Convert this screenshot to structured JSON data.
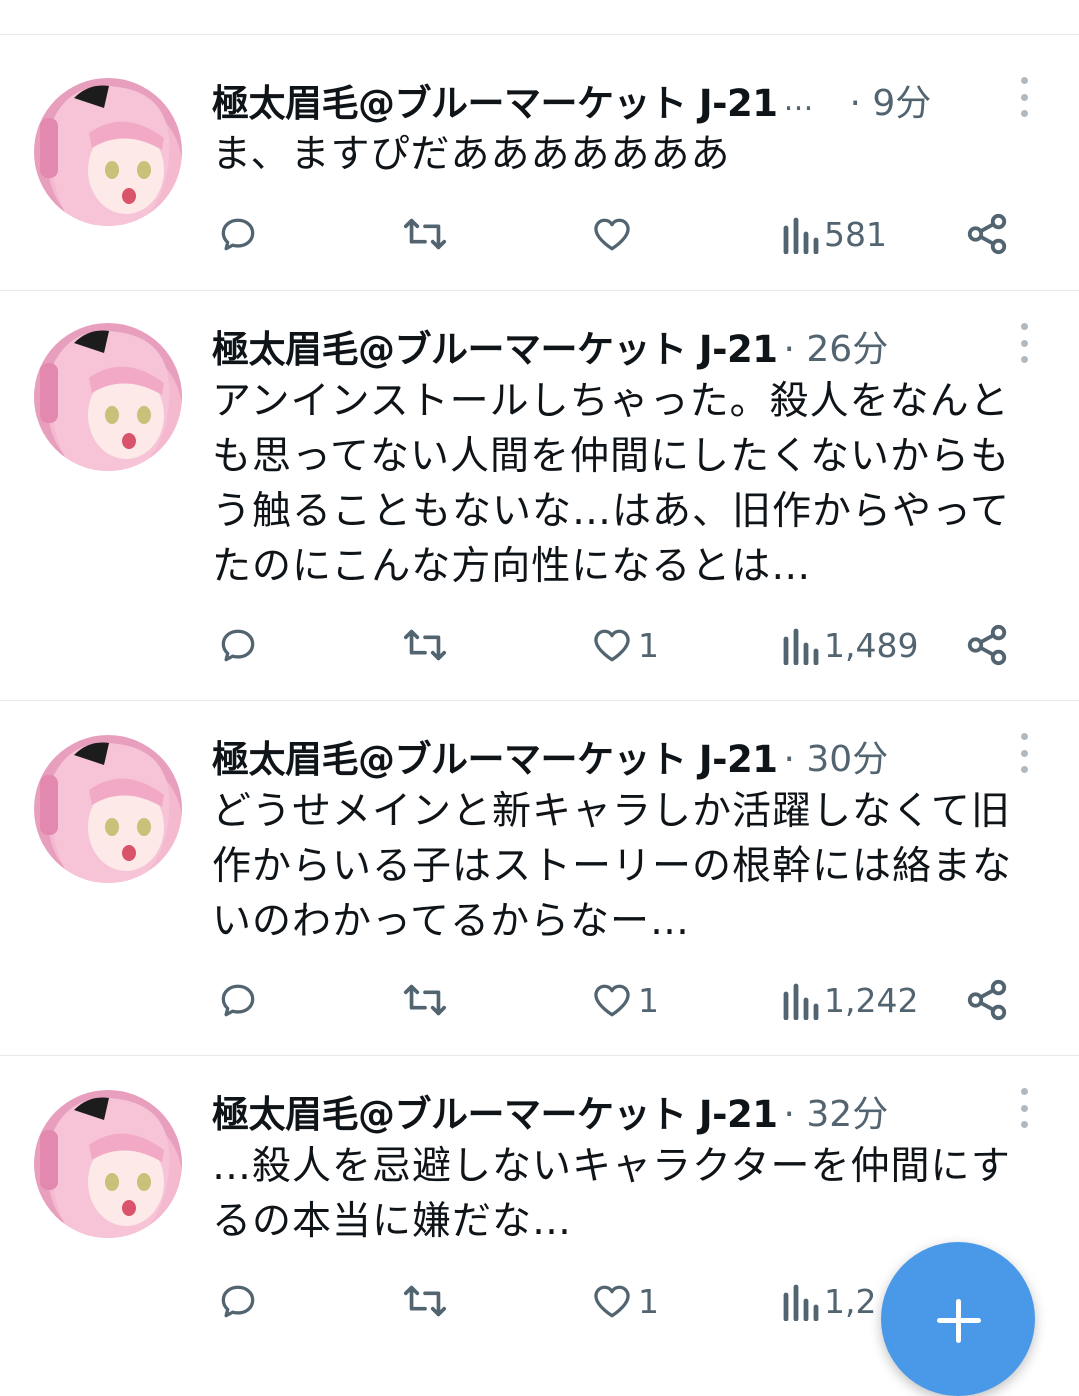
{
  "timeline": {
    "tweets": [
      {
        "author": "極太眉毛@ブルーマーケット J-21",
        "truncation": "…",
        "time": "· 9分",
        "text_lines": [
          "ま、ますぴだあああああああ"
        ],
        "reply_count": "",
        "retweet_count": "",
        "like_count": "",
        "views": "581"
      },
      {
        "author": "極太眉毛@ブルーマーケット J-21",
        "time": "· 26分",
        "text_lines": [
          "アンインストールしちゃった。殺人をなんと",
          "も思ってない人間を仲間にしたくないからも",
          "う触ることもないな…はあ、旧作からやって",
          "たのにこんな方向性になるとは…"
        ],
        "reply_count": "",
        "retweet_count": "",
        "like_count": "1",
        "views": "1,489"
      },
      {
        "author": "極太眉毛@ブルーマーケット J-21",
        "time": "· 30分",
        "text_lines": [
          "どうせメインと新キャラしか活躍しなくて旧",
          "作からいる子はストーリーの根幹には絡まな",
          "いのわかってるからなー…"
        ],
        "reply_count": "",
        "retweet_count": "",
        "like_count": "1",
        "views": "1,242"
      },
      {
        "author": "極太眉毛@ブルーマーケット J-21",
        "time": "· 32分",
        "text_lines": [
          "…殺人を忌避しないキャラクターを仲間にす",
          "るの本当に嫌だな…"
        ],
        "reply_count": "",
        "retweet_count": "",
        "like_count": "1",
        "views": "1,2"
      }
    ]
  },
  "icons": {
    "reply": "reply-bubble-icon",
    "retweet": "retweet-arrows-icon",
    "like": "heart-icon",
    "views": "bar-chart-icon",
    "share": "share-nodes-icon",
    "more": "vertical-dots-icon",
    "compose": "plus-icon"
  },
  "colors": {
    "text_primary": "#0f1419",
    "text_secondary": "#536471",
    "icon": "#536471",
    "divider": "#e7e9ea",
    "fab": "#4a99e9"
  }
}
